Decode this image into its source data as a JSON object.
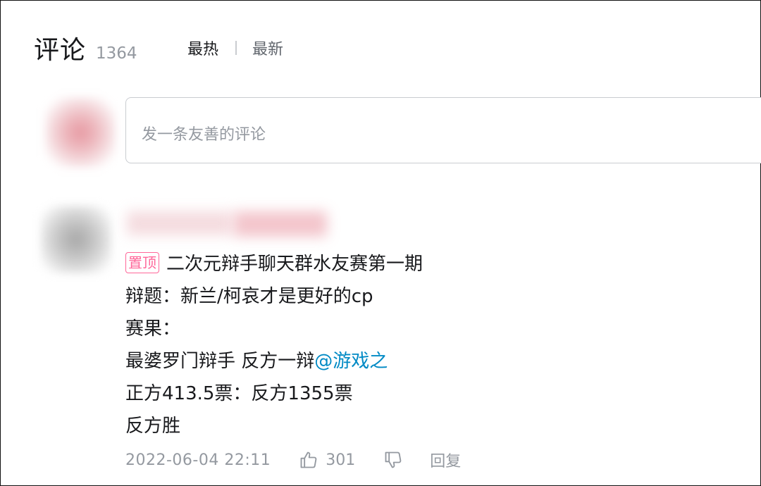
{
  "header": {
    "title": "评论",
    "count": "1364"
  },
  "sort": {
    "hot": "最热",
    "new": "最新"
  },
  "composer": {
    "placeholder": "发一条友善的评论"
  },
  "comment": {
    "pin_badge": "置顶",
    "lines": [
      "二次元辩手聊天群水友赛第一期",
      "辩题：新兰/柯哀才是更好的cp",
      "赛果：",
      "最婆罗门辩手 反方一辩",
      "正方413.5票：反方1355票",
      "反方胜"
    ],
    "mention": "@游戏之",
    "time": "2022-06-04 22:11",
    "likes": "301",
    "reply": "回复"
  },
  "colors": {
    "accent_pink": "#ff6699",
    "mention_blue": "#008ac5",
    "muted": "#9499a0"
  }
}
